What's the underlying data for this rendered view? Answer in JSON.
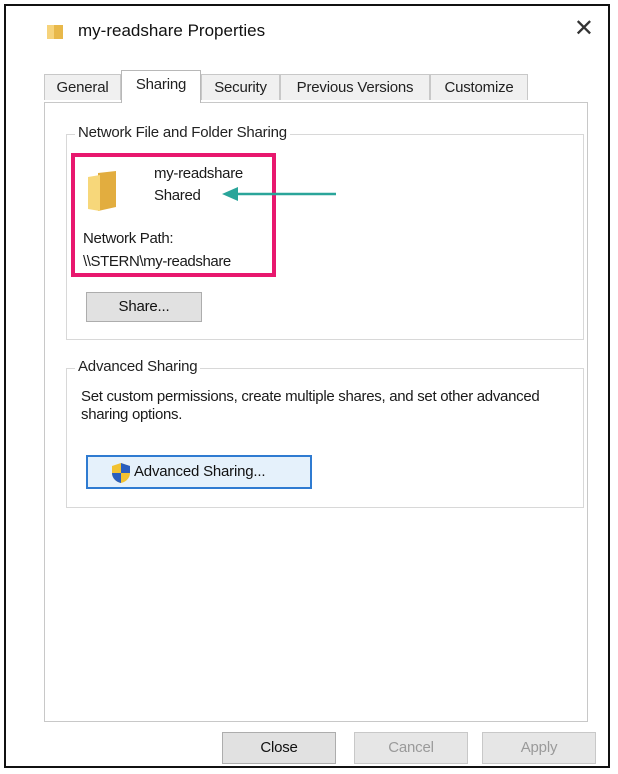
{
  "window": {
    "title": "my-readshare Properties",
    "close_glyph": "✕",
    "icon": "folder-icon"
  },
  "tabs": [
    {
      "label": "General",
      "active": false
    },
    {
      "label": "Sharing",
      "active": true
    },
    {
      "label": "Security",
      "active": false
    },
    {
      "label": "Previous Versions",
      "active": false
    },
    {
      "label": "Customize",
      "active": false
    }
  ],
  "network_sharing": {
    "group_title": "Network File and Folder Sharing",
    "share_name": "my-readshare",
    "share_status": "Shared",
    "network_path_label": "Network Path:",
    "network_path_value": "\\\\STERN\\my-readshare",
    "share_button": "Share...",
    "highlight_color": "#e8186e",
    "arrow_color": "#2aa59a"
  },
  "advanced_sharing": {
    "group_title": "Advanced Sharing",
    "description": "Set custom permissions, create multiple shares, and set other advanced sharing options.",
    "button": "Advanced Sharing..."
  },
  "footer": {
    "close": "Close",
    "cancel": "Cancel",
    "apply": "Apply"
  }
}
